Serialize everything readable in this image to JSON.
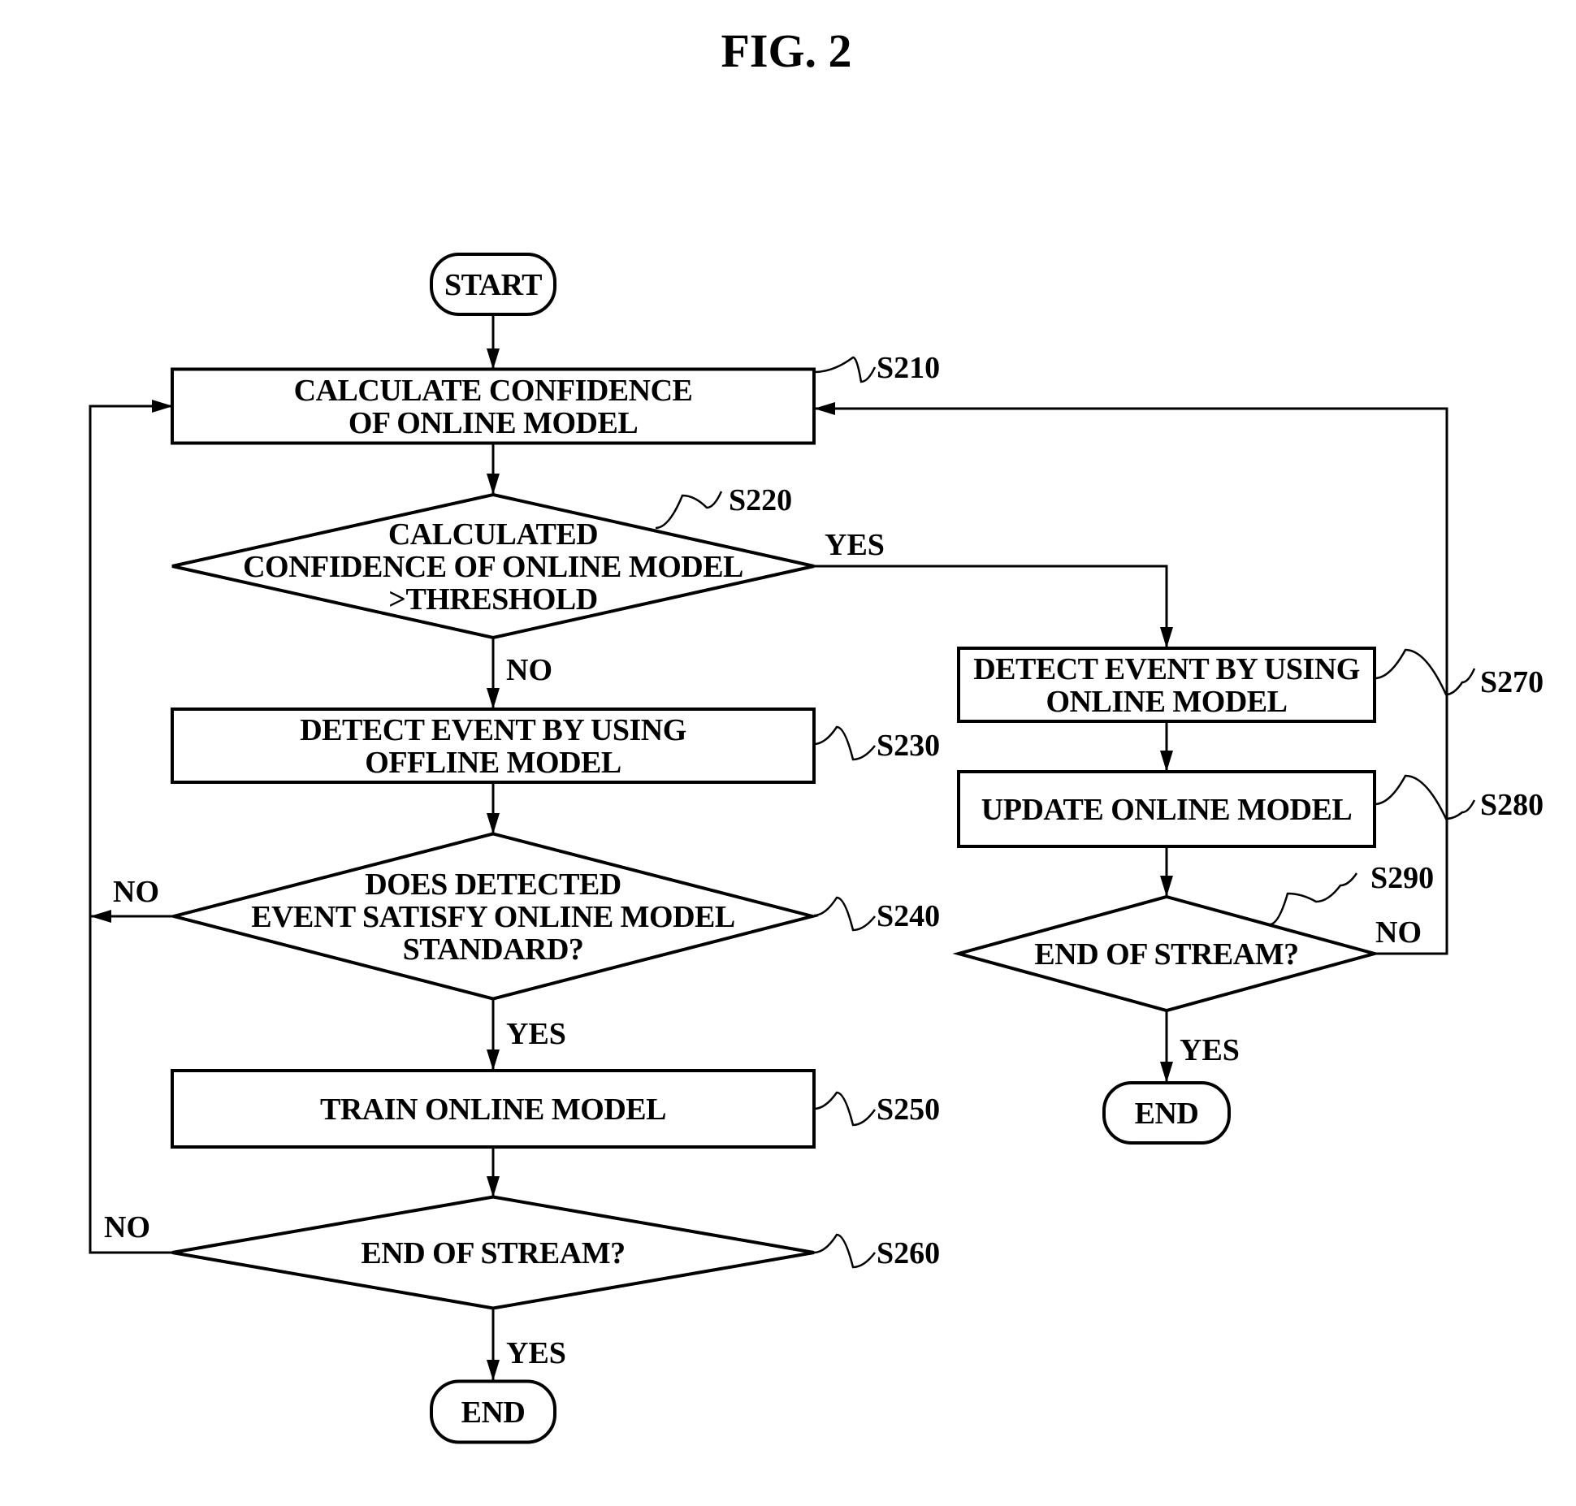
{
  "figure": {
    "title": "FIG. 2"
  },
  "nodes": [
    {
      "id": "start",
      "type": "terminal",
      "lines": [
        "START"
      ]
    },
    {
      "id": "S210",
      "type": "process",
      "step": "S210",
      "lines": [
        "CALCULATE CONFIDENCE",
        "OF ONLINE MODEL"
      ]
    },
    {
      "id": "S220",
      "type": "decision",
      "step": "S220",
      "lines": [
        "CALCULATED",
        "CONFIDENCE OF ONLINE MODEL",
        ">THRESHOLD"
      ]
    },
    {
      "id": "S230",
      "type": "process",
      "step": "S230",
      "lines": [
        "DETECT EVENT BY USING",
        "OFFLINE MODEL"
      ]
    },
    {
      "id": "S240",
      "type": "decision",
      "step": "S240",
      "lines": [
        "DOES DETECTED",
        "EVENT SATISFY ONLINE MODEL",
        "STANDARD?"
      ]
    },
    {
      "id": "S250",
      "type": "process",
      "step": "S250",
      "lines": [
        "TRAIN ONLINE MODEL"
      ]
    },
    {
      "id": "S260",
      "type": "decision",
      "step": "S260",
      "lines": [
        "END OF STREAM?"
      ]
    },
    {
      "id": "end1",
      "type": "terminal",
      "lines": [
        "END"
      ]
    },
    {
      "id": "S270",
      "type": "process",
      "step": "S270",
      "lines": [
        "DETECT EVENT BY USING",
        "ONLINE MODEL"
      ]
    },
    {
      "id": "S280",
      "type": "process",
      "step": "S280",
      "lines": [
        "UPDATE ONLINE MODEL"
      ]
    },
    {
      "id": "S290",
      "type": "decision",
      "step": "S290",
      "lines": [
        "END OF STREAM?"
      ]
    },
    {
      "id": "end2",
      "type": "terminal",
      "lines": [
        "END"
      ]
    }
  ],
  "edges": [
    {
      "id": "start-S210",
      "from": "start",
      "to": "S210",
      "label": ""
    },
    {
      "id": "S210-S220",
      "from": "S210",
      "to": "S220",
      "label": ""
    },
    {
      "id": "S220-S230",
      "from": "S220",
      "to": "S230",
      "label": "NO"
    },
    {
      "id": "S220-S270",
      "from": "S220",
      "to": "S270",
      "label": "YES"
    },
    {
      "id": "S230-S240",
      "from": "S230",
      "to": "S240",
      "label": ""
    },
    {
      "id": "S240-S210",
      "from": "S240",
      "to": "S210",
      "label": "NO"
    },
    {
      "id": "S240-S250",
      "from": "S240",
      "to": "S250",
      "label": "YES"
    },
    {
      "id": "S250-S260",
      "from": "S250",
      "to": "S260",
      "label": ""
    },
    {
      "id": "S260-S210",
      "from": "S260",
      "to": "S210",
      "label": "NO"
    },
    {
      "id": "S260-end1",
      "from": "S260",
      "to": "end1",
      "label": "YES"
    },
    {
      "id": "S270-S280",
      "from": "S270",
      "to": "S280",
      "label": ""
    },
    {
      "id": "S280-S290",
      "from": "S280",
      "to": "S290",
      "label": ""
    },
    {
      "id": "S290-S210",
      "from": "S290",
      "to": "S210",
      "label": "NO"
    },
    {
      "id": "S290-end2",
      "from": "S290",
      "to": "end2",
      "label": "YES"
    }
  ]
}
